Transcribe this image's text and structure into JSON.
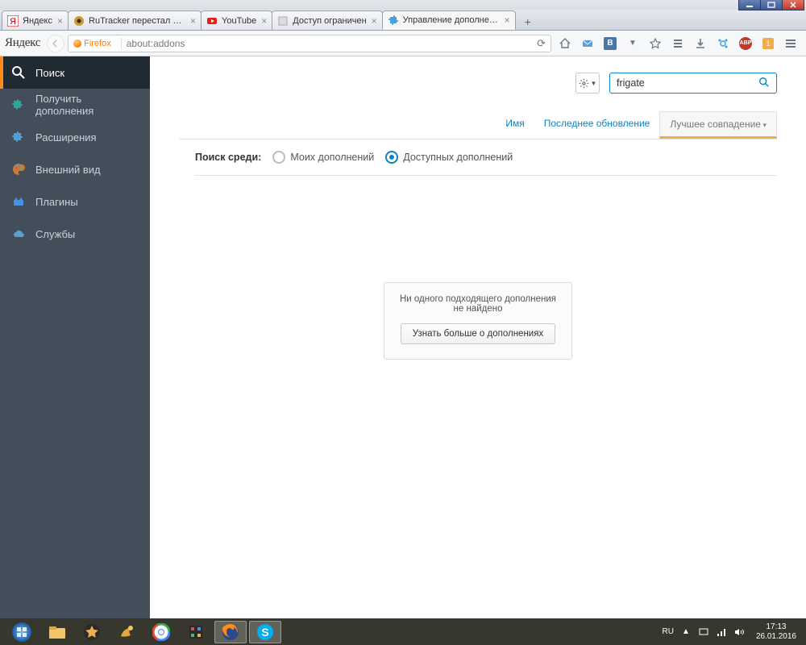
{
  "window": {
    "tabs": [
      {
        "label": "Яндекс"
      },
      {
        "label": "RuTracker перестал проги…"
      },
      {
        "label": "YouTube"
      },
      {
        "label": "Доступ ограничен"
      },
      {
        "label": "Управление дополнениями",
        "active": true
      }
    ]
  },
  "urlbar": {
    "logo": "Яндекс",
    "identity_label": "Firefox",
    "address": "about:addons"
  },
  "toolbar": {
    "vk_text": "B",
    "abp_text": "ABP",
    "badge_text": "1"
  },
  "sidebar": {
    "items": [
      {
        "label": "Поиск",
        "icon": "search",
        "active": true
      },
      {
        "label": "Получить дополнения",
        "icon": "puzzle-get"
      },
      {
        "label": "Расширения",
        "icon": "puzzle"
      },
      {
        "label": "Внешний вид",
        "icon": "palette"
      },
      {
        "label": "Плагины",
        "icon": "brick"
      },
      {
        "label": "Службы",
        "icon": "cloud"
      }
    ]
  },
  "content": {
    "search_value": "frigate",
    "sort_items": [
      {
        "label": "Имя"
      },
      {
        "label": "Последнее обновление"
      },
      {
        "label": "Лучшее совпадение",
        "active": true
      }
    ],
    "filter_label": "Поиск среди:",
    "filter_options": [
      {
        "label": "Моих дополнений",
        "checked": false
      },
      {
        "label": "Доступных дополнений",
        "checked": true
      }
    ],
    "empty_message": "Ни одного подходящего дополнения не найдено",
    "learn_more": "Узнать больше о дополнениях"
  },
  "taskbar": {
    "lang": "RU",
    "time": "17:13",
    "date": "26.01.2016"
  }
}
